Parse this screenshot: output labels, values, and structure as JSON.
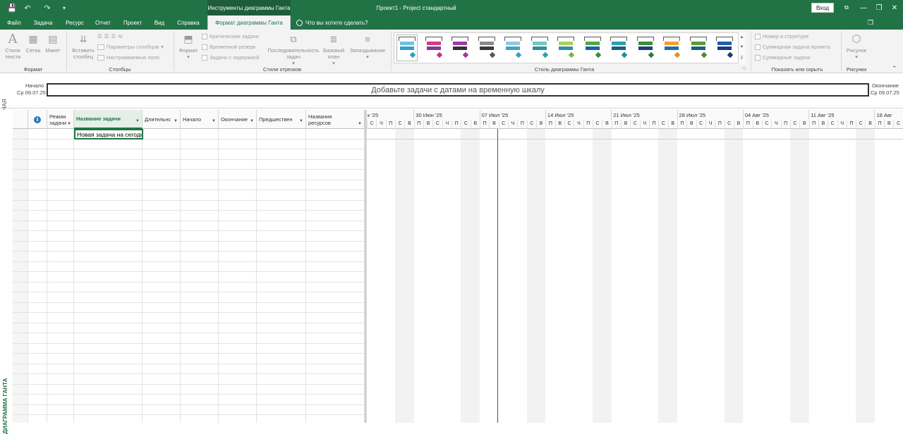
{
  "window": {
    "title": "Проект1  -  Project стандартный",
    "tools_context": "Инструменты диаграммы Ганта",
    "signin": "Вход",
    "qat": {
      "save": "💾",
      "undo": "↶",
      "redo": "↷",
      "customize": "▾"
    },
    "controls": {
      "ribbon_display": "⧉",
      "minimize": "—",
      "restore": "❐",
      "close": "✕"
    }
  },
  "tabs": [
    {
      "id": "file",
      "label": "Файл"
    },
    {
      "id": "task",
      "label": "Задача"
    },
    {
      "id": "resource",
      "label": "Ресурс"
    },
    {
      "id": "report",
      "label": "Отчет"
    },
    {
      "id": "project",
      "label": "Проект"
    },
    {
      "id": "view",
      "label": "Вид"
    },
    {
      "id": "help",
      "label": "Справка"
    },
    {
      "id": "format",
      "label": "Формат диаграммы Ганта",
      "active": true
    }
  ],
  "tell_me": "Что вы хотите сделать?",
  "ribbon": {
    "format_group": {
      "label": "Формат",
      "text_styles": "Стили текста",
      "gridlines": "Сетка",
      "layout": "Макет"
    },
    "columns_group": {
      "label": "Столбцы",
      "insert_column": "Вставить столбец",
      "column_settings": "Параметры столбцов",
      "custom_fields": "Настраиваемые поля"
    },
    "bar_styles_group": {
      "label": "Стили отрезков",
      "format": "Формат",
      "critical_tasks": "Критические задачи",
      "slack": "Временной резерв",
      "late_tasks": "Задачи с задержкой",
      "task_path": "Последовательность задач",
      "baseline": "Базовый план",
      "slippage": "Запаздывание"
    },
    "gantt_style_group": {
      "label": "Стиль диаграммы Ганта",
      "styles": [
        {
          "bar1": "#6fc3e0",
          "bar2": "#3a9ec8",
          "milestone": "#2a9fb3"
        },
        {
          "bar1": "#d03a8c",
          "bar2": "#7a3f9a",
          "milestone": "#c2348a"
        },
        {
          "bar1": "#a03aa8",
          "bar2": "#333333",
          "milestone": "#9b3aa0"
        },
        {
          "bar1": "#8a8a8a",
          "bar2": "#3a3a3a",
          "milestone": "#555555"
        },
        {
          "bar1": "#8dc9df",
          "bar2": "#4a9ec0",
          "milestone": "#3aa0b8"
        },
        {
          "bar1": "#6fc7c7",
          "bar2": "#2e8f9a",
          "milestone": "#2e9fa8"
        },
        {
          "bar1": "#a8d05a",
          "bar2": "#2e8fb0",
          "milestone": "#7ab83a"
        },
        {
          "bar1": "#4aa84a",
          "bar2": "#1e5ea8",
          "milestone": "#2e8f3a"
        },
        {
          "bar1": "#2aa0b0",
          "bar2": "#1e5e7a",
          "milestone": "#1e8f9a"
        },
        {
          "bar1": "#3a8f3a",
          "bar2": "#1e3e7a",
          "milestone": "#2e7a3a"
        },
        {
          "bar1": "#f0a030",
          "bar2": "#1e6ea8",
          "milestone": "#e09020"
        },
        {
          "bar1": "#5a9a3a",
          "bar2": "#1e5e7a",
          "milestone": "#4a8a2a"
        },
        {
          "bar1": "#1e5ea8",
          "bar2": "#1e3a7a",
          "milestone": "#1e3a6a"
        }
      ]
    },
    "show_hide_group": {
      "label": "Показать или скрыть",
      "outline_number": "Номер в структуре",
      "project_summary": "Суммарная задача проекта",
      "summary_tasks": "Суммарные задачи"
    },
    "drawings_group": {
      "label": "Рисунки",
      "drawing": "Рисунок"
    }
  },
  "timeline": {
    "side_label": "ВРЕМЕННАЯ",
    "start_label": "Начало",
    "start_date": "Ср 09.07.25",
    "end_label": "Окончание",
    "end_date": "Ср 09.07.25",
    "placeholder": "Добавьте задачи с датами на временную шкалу"
  },
  "gantt": {
    "side_label": "ДИАГРАММА ГАНТА",
    "columns": [
      {
        "id": "info",
        "label": ""
      },
      {
        "id": "mode",
        "label": "Режим задачи"
      },
      {
        "id": "name",
        "label": "Название задачи"
      },
      {
        "id": "duration",
        "label": "Длительнс"
      },
      {
        "id": "start",
        "label": "Начало"
      },
      {
        "id": "finish",
        "label": "Окончание"
      },
      {
        "id": "predecessors",
        "label": "Предшествен"
      },
      {
        "id": "resources",
        "label": "Названия ресурсов"
      }
    ],
    "editing_value": "Новая задача на сегодня",
    "weeks": [
      "к '25",
      "30 Июн '25",
      "07 Июл '25",
      "14 Июл '25",
      "21 Июл '25",
      "28 Июл '25",
      "04 Авг '25",
      "11 Авг '25",
      "18 Авг"
    ],
    "day_letters": [
      "С",
      "Ч",
      "П",
      "С",
      "В",
      "П",
      "В",
      "С",
      "Ч",
      "П",
      "С",
      "В",
      "П",
      "В",
      "С",
      "Ч",
      "П",
      "С",
      "В",
      "П",
      "В",
      "С",
      "Ч",
      "П",
      "С",
      "В",
      "П",
      "В",
      "С",
      "Ч",
      "П",
      "С",
      "В",
      "П",
      "В",
      "С",
      "Ч",
      "П",
      "С",
      "В",
      "П",
      "В",
      "С",
      "Ч",
      "П",
      "С",
      "В",
      "П",
      "В",
      "С",
      "Ч",
      "П",
      "С",
      "В",
      "П",
      "В",
      "С"
    ]
  }
}
